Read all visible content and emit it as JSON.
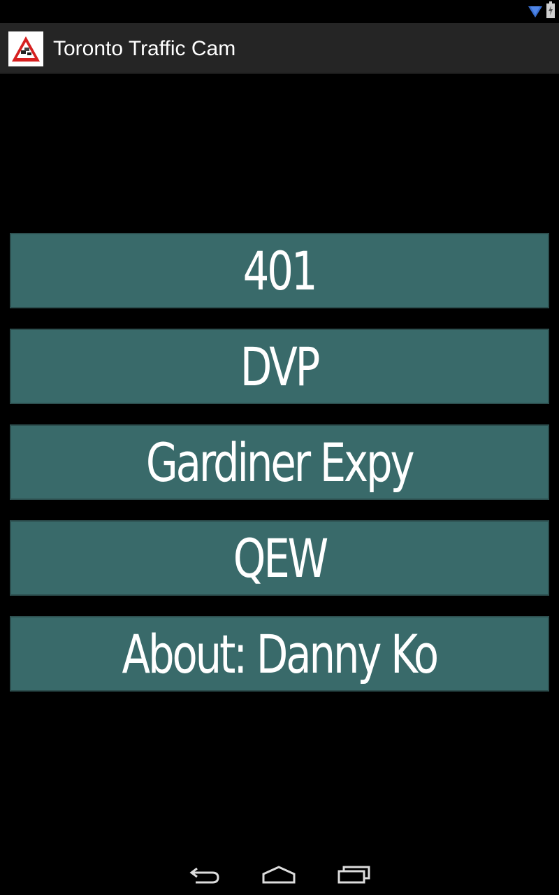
{
  "app": {
    "title": "Toronto Traffic Cam",
    "icon": "traffic-warning-sign-icon"
  },
  "status_bar": {
    "icons": [
      "wifi-icon",
      "battery-icon"
    ]
  },
  "menu": {
    "items": [
      {
        "label": "401"
      },
      {
        "label": "DVP"
      },
      {
        "label": "Gardiner Expy"
      },
      {
        "label": "QEW"
      },
      {
        "label": "About: Danny Ko"
      }
    ]
  },
  "nav_bar": {
    "buttons": [
      "back-icon",
      "home-icon",
      "recent-apps-icon"
    ]
  },
  "colors": {
    "button_bg": "#396a6a",
    "action_bar_bg": "#252525",
    "background": "#000000"
  }
}
